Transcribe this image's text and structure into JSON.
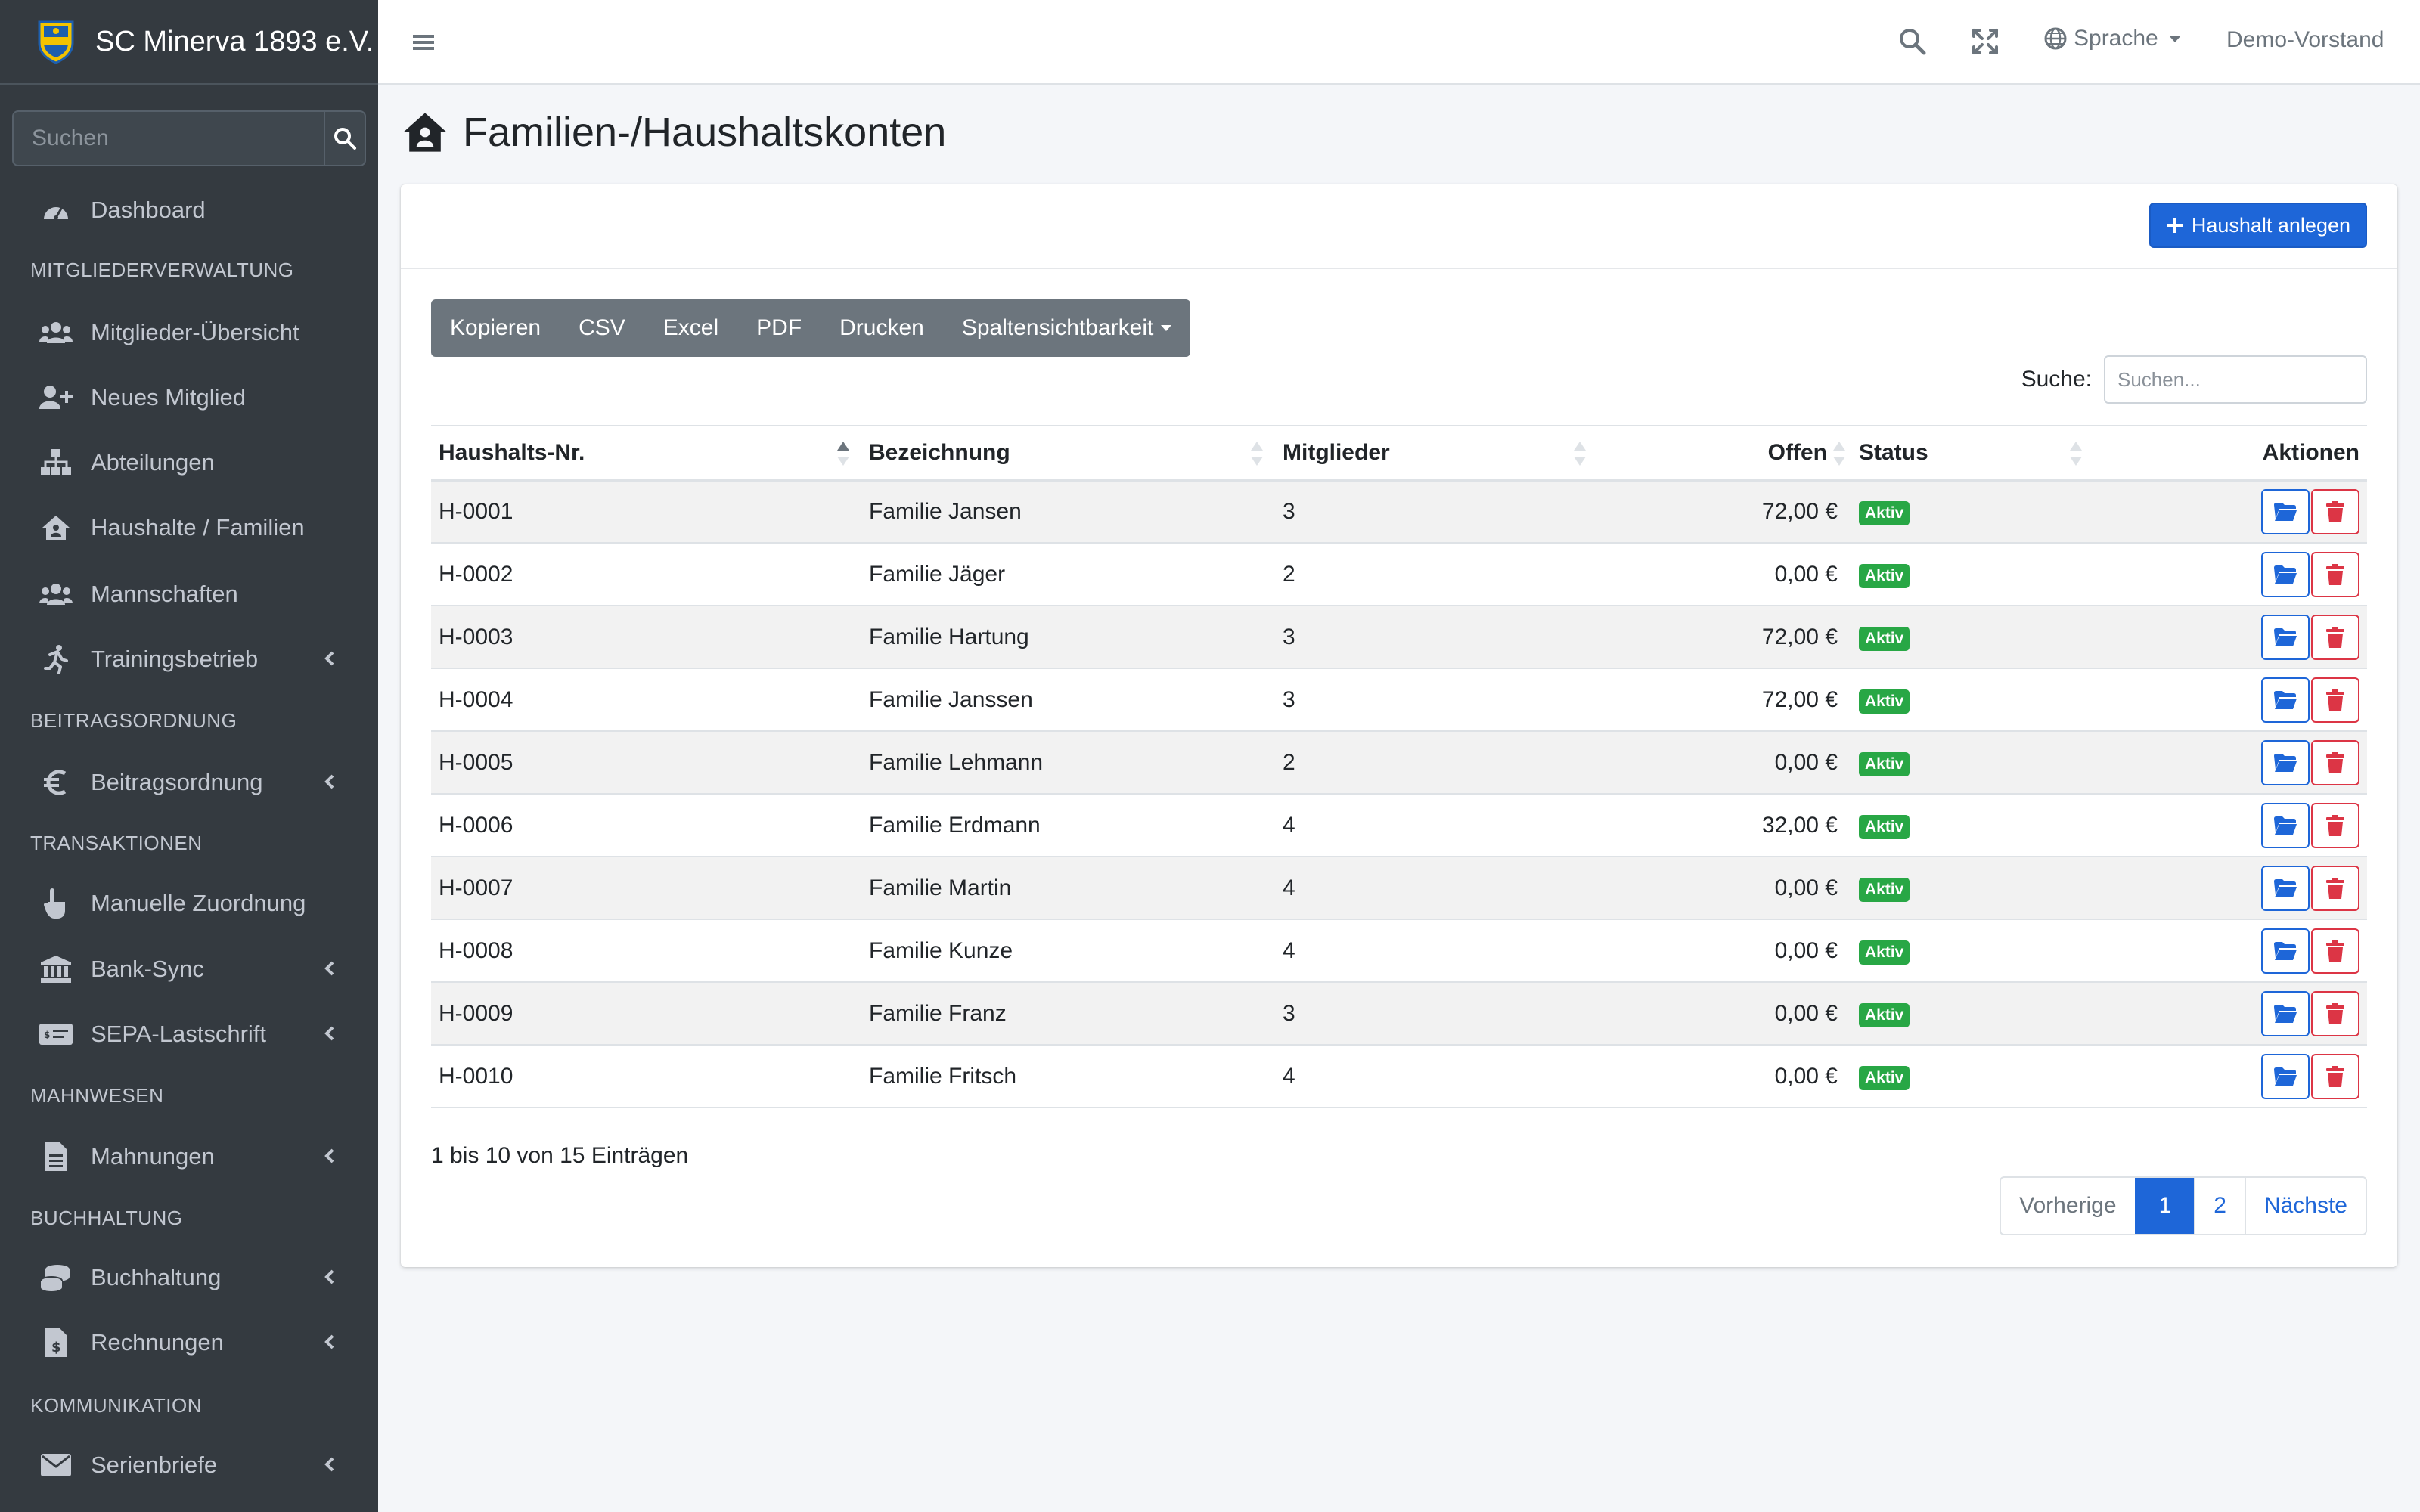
{
  "brand": {
    "name": "SC Minerva 1893 e.V."
  },
  "sidebar": {
    "search_placeholder": "Suchen",
    "items": [
      {
        "label": "Dashboard",
        "icon": "tachometer-icon"
      },
      {
        "label": "Mitglieder-Übersicht",
        "icon": "users-icon"
      },
      {
        "label": "Neues Mitglied",
        "icon": "user-plus-icon"
      },
      {
        "label": "Abteilungen",
        "icon": "sitemap-icon"
      },
      {
        "label": "Haushalte / Familien",
        "icon": "house-user-icon"
      },
      {
        "label": "Mannschaften",
        "icon": "users-icon"
      },
      {
        "label": "Trainingsbetrieb",
        "icon": "running-icon"
      },
      {
        "label": "Beitragsordnung",
        "icon": "euro-icon"
      },
      {
        "label": "Manuelle Zuordnung",
        "icon": "hand-pointer-icon"
      },
      {
        "label": "Bank-Sync",
        "icon": "bank-icon"
      },
      {
        "label": "SEPA-Lastschrift",
        "icon": "money-check-icon"
      },
      {
        "label": "Mahnungen",
        "icon": "file-alt-icon"
      },
      {
        "label": "Buchhaltung",
        "icon": "coins-icon"
      },
      {
        "label": "Rechnungen",
        "icon": "file-invoice-dollar-icon"
      },
      {
        "label": "Serienbriefe",
        "icon": "envelope-icon"
      }
    ],
    "headers": [
      "MITGLIEDERVERWALTUNG",
      "BEITRAGSORDNUNG",
      "TRANSAKTIONEN",
      "MAHNWESEN",
      "BUCHHALTUNG",
      "KOMMUNIKATION"
    ]
  },
  "topbar": {
    "language": "Sprache",
    "user": "Demo-Vorstand"
  },
  "page": {
    "title": "Familien-/Haushaltskonten"
  },
  "card": {
    "add_button": "Haushalt anlegen"
  },
  "toolbar": {
    "buttons": [
      "Kopieren",
      "CSV",
      "Excel",
      "PDF",
      "Drucken",
      "Spaltensichtbarkeit"
    ]
  },
  "table_search": {
    "label": "Suche:",
    "placeholder": "Suchen..."
  },
  "table": {
    "headers": [
      "Haushalts-Nr.",
      "Bezeichnung",
      "Mitglieder",
      "Offen",
      "Status",
      "Aktionen"
    ],
    "rows": [
      {
        "nr": "H-0001",
        "name": "Familie Jansen",
        "members": "3",
        "open": "72,00 €",
        "status": "Aktiv"
      },
      {
        "nr": "H-0002",
        "name": "Familie Jäger",
        "members": "2",
        "open": "0,00 €",
        "status": "Aktiv"
      },
      {
        "nr": "H-0003",
        "name": "Familie Hartung",
        "members": "3",
        "open": "72,00 €",
        "status": "Aktiv"
      },
      {
        "nr": "H-0004",
        "name": "Familie Janssen",
        "members": "3",
        "open": "72,00 €",
        "status": "Aktiv"
      },
      {
        "nr": "H-0005",
        "name": "Familie Lehmann",
        "members": "2",
        "open": "0,00 €",
        "status": "Aktiv"
      },
      {
        "nr": "H-0006",
        "name": "Familie Erdmann",
        "members": "4",
        "open": "32,00 €",
        "status": "Aktiv"
      },
      {
        "nr": "H-0007",
        "name": "Familie Martin",
        "members": "4",
        "open": "0,00 €",
        "status": "Aktiv"
      },
      {
        "nr": "H-0008",
        "name": "Familie Kunze",
        "members": "4",
        "open": "0,00 €",
        "status": "Aktiv"
      },
      {
        "nr": "H-0009",
        "name": "Familie Franz",
        "members": "3",
        "open": "0,00 €",
        "status": "Aktiv"
      },
      {
        "nr": "H-0010",
        "name": "Familie Fritsch",
        "members": "4",
        "open": "0,00 €",
        "status": "Aktiv"
      }
    ]
  },
  "info": "1 bis 10 von 15 Einträgen",
  "pagination": {
    "prev": "Vorherige",
    "pages": [
      "1",
      "2"
    ],
    "next": "Nächste",
    "current": "1"
  },
  "colors": {
    "primary": "#1e66d8",
    "danger": "#dc3545",
    "success": "#28a745",
    "sidebar": "#343a40"
  }
}
